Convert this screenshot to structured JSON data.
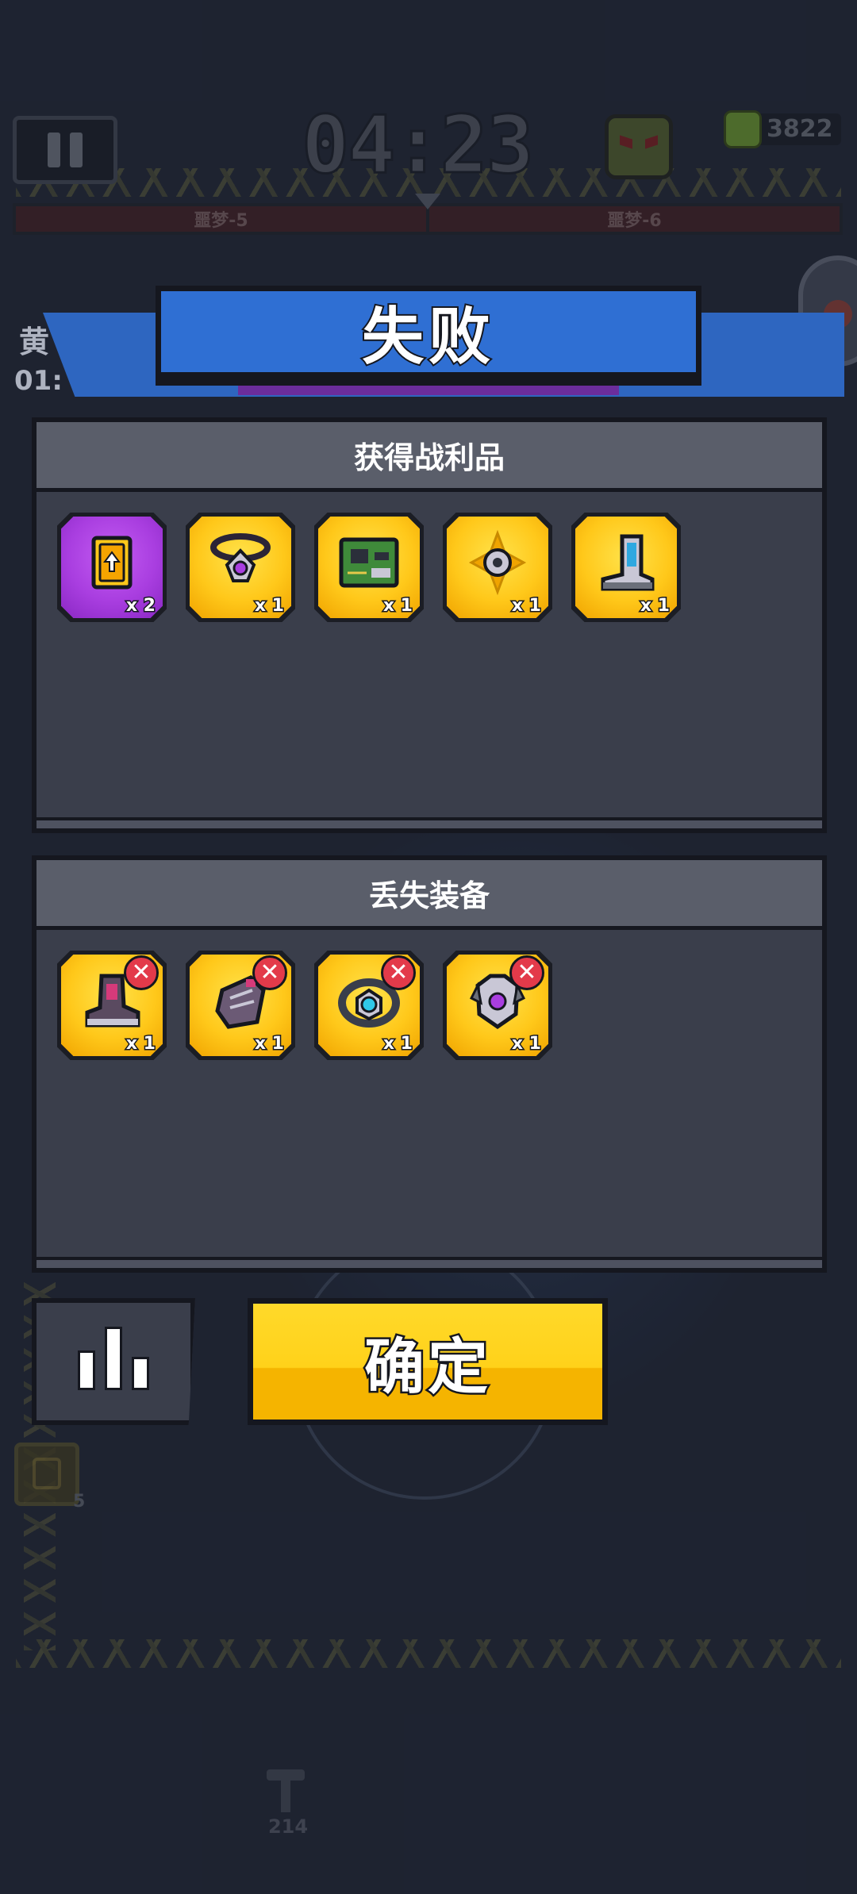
{
  "hud": {
    "timer": "04:23",
    "currency": "3822",
    "progress_left": "噩梦-5",
    "progress_right": "噩梦-6",
    "left_edge_top": "黄",
    "left_edge_bottom": "01:",
    "side_card_count": "5",
    "bottom_count": "214"
  },
  "modal": {
    "title": "失败",
    "loot": {
      "header": "获得战利品",
      "items": [
        {
          "name": "upgrade-card",
          "qty": "x 2",
          "rarity": "purple"
        },
        {
          "name": "necklace",
          "qty": "x 1",
          "rarity": "gold"
        },
        {
          "name": "circuit-board",
          "qty": "x 1",
          "rarity": "gold"
        },
        {
          "name": "gear-core",
          "qty": "x 1",
          "rarity": "gold"
        },
        {
          "name": "boots",
          "qty": "x 1",
          "rarity": "gold"
        }
      ]
    },
    "lost": {
      "header": "丢失装备",
      "items": [
        {
          "name": "boots",
          "qty": "x 1"
        },
        {
          "name": "gloves",
          "qty": "x 1"
        },
        {
          "name": "belt",
          "qty": "x 1"
        },
        {
          "name": "armor",
          "qty": "x 1"
        }
      ]
    },
    "confirm_label": "确定"
  },
  "colors": {
    "gold": "#ffc81a",
    "purple": "#a93ee0",
    "title_blue": "#2f6fd3",
    "lost_mark": "#e33a4a"
  }
}
